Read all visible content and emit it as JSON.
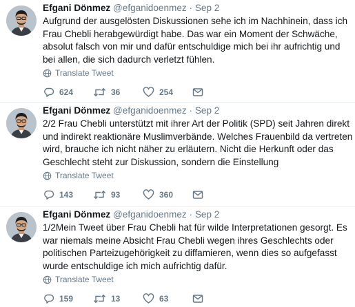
{
  "tweets": [
    {
      "name": "Efgani Dönmez",
      "handle": "@efganidoenmez",
      "separator": "·",
      "date": "Sep 2",
      "text": "Aufgrund der ausgelösten Diskussionen sehe ich im Nachhinein, dass ich Frau Chebli herabgewürdigt habe. Das war ein Moment der Schwäche, absolut falsch von mir und dafür entschuldige mich bei ihr aufrichtig und bei allen, die sich dadurch verletzt fühlen.",
      "translate_label": "Translate Tweet",
      "replies": "624",
      "retweets": "36",
      "likes": "254"
    },
    {
      "name": "Efgani Dönmez",
      "handle": "@efganidoenmez",
      "separator": "·",
      "date": "Sep 2",
      "text": "2/2 Frau Chebli unterstützt mit ihrer Art der Politik (SPD) seit Jahren direkt und indirekt reaktionäre Muslimverbände. Welches Frauenbild da vertreten wird, brauche ich nicht näher zu erläutern. Nicht die Herkunft oder das Geschlecht steht zur Diskussion, sondern die Einstellung",
      "translate_label": "Translate Tweet",
      "replies": "143",
      "retweets": "93",
      "likes": "360"
    },
    {
      "name": "Efgani Dönmez",
      "handle": "@efganidoenmez",
      "separator": "·",
      "date": "Sep 2",
      "text": "1/2Mein Tweet über Frau Chebli hat für wilde Interpretationen gesorgt. Es war niemals meine Absicht Frau Chebli wegen ihres Geschlechts oder politischen Parteizugehörigkeit zu diffamieren, wenn dies so aufgefasst wurde entschuldige ich mich aufrichtig dafür.",
      "translate_label": "Translate Tweet",
      "replies": "159",
      "retweets": "13",
      "likes": "63"
    }
  ],
  "colors": {
    "text": "#14171a",
    "muted": "#657786",
    "divider": "#e6ecf0",
    "background": "#ffffff"
  }
}
